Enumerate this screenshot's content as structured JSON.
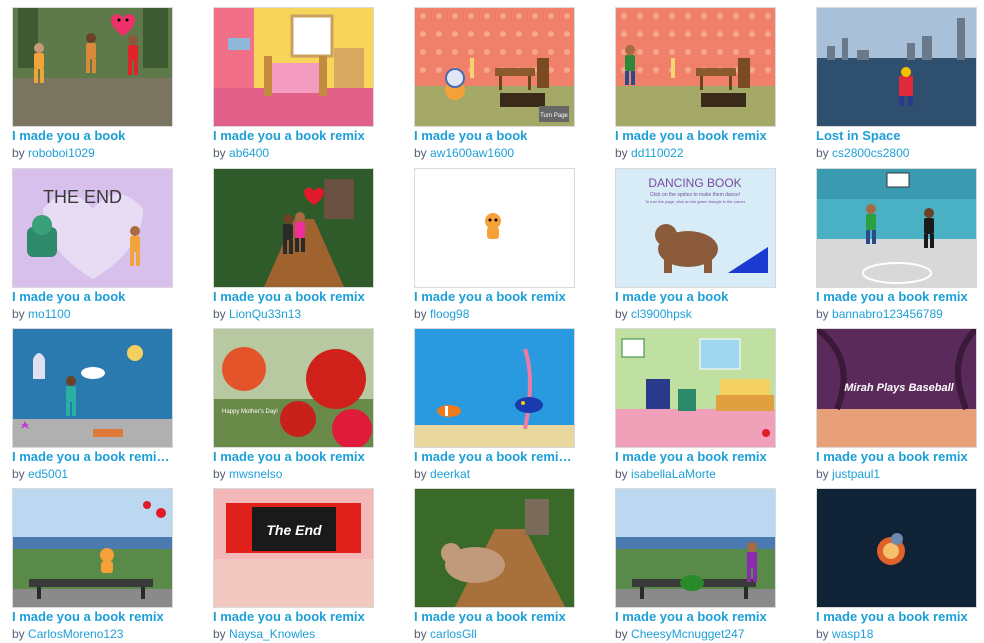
{
  "by_prefix": "by",
  "projects": [
    {
      "title": "I made you a book",
      "owner": "roboboi1029",
      "thumb": "family-garden"
    },
    {
      "title": "I made you a book remix",
      "owner": "ab6400",
      "thumb": "pink-bedroom"
    },
    {
      "title": "I made you a book",
      "owner": "aw1600aw1600",
      "thumb": "orange-room-astronaut",
      "caption": "Turn Page"
    },
    {
      "title": "I made you a book remix",
      "owner": "dd110022",
      "thumb": "orange-room-person"
    },
    {
      "title": "Lost in Space",
      "owner": "cs2800cs2800",
      "thumb": "city-river"
    },
    {
      "title": "I made you a book",
      "owner": "mo1100",
      "thumb": "the-end-heart",
      "caption": "THE END"
    },
    {
      "title": "I made you a book remix",
      "owner": "LionQu33n13",
      "thumb": "forest-path-heart"
    },
    {
      "title": "I made you a book remix",
      "owner": "floog98",
      "thumb": "scratch-cat-blank"
    },
    {
      "title": "I made you a book",
      "owner": "cl3900hpsk",
      "thumb": "dancing-book-bear",
      "caption": "DANCING BOOK",
      "sub1": "Click on the sprites to make them dance!",
      "sub2": "To turn the page, click on the green triangle in the corner"
    },
    {
      "title": "I made you a book remix",
      "owner": "bannabro123456789",
      "thumb": "basketball-court"
    },
    {
      "title": "I made you a book remi…",
      "owner": "ed5001",
      "thumb": "underwater-mermaid"
    },
    {
      "title": "I made you a book remix",
      "owner": "mwsnelso",
      "thumb": "red-flowers",
      "caption": "Happy Mother's Day!"
    },
    {
      "title": "I made you a book remi…",
      "owner": "deerkat",
      "thumb": "ocean-fish"
    },
    {
      "title": "I made you a book remix",
      "owner": "isabellaLaMorte",
      "thumb": "kids-bedroom"
    },
    {
      "title": "I made you a book remix",
      "owner": "justpaul1",
      "thumb": "jungle-baseball",
      "caption": "Mirah Plays Baseball"
    },
    {
      "title": "I made you a book remix",
      "owner": "CarlosMoreno123",
      "thumb": "hilltop-bench-cat"
    },
    {
      "title": "I made you a book remix",
      "owner": "Naysa_Knowles",
      "thumb": "theater-the-end",
      "caption": "The End"
    },
    {
      "title": "I made you a book remix",
      "owner": "carlosGll",
      "thumb": "forest-bear"
    },
    {
      "title": "I made you a book remix",
      "owner": "CheesyMcnugget247",
      "thumb": "hilltop-bench-watermelon"
    },
    {
      "title": "I made you a book remix",
      "owner": "wasp18",
      "thumb": "dark-explosion"
    }
  ]
}
